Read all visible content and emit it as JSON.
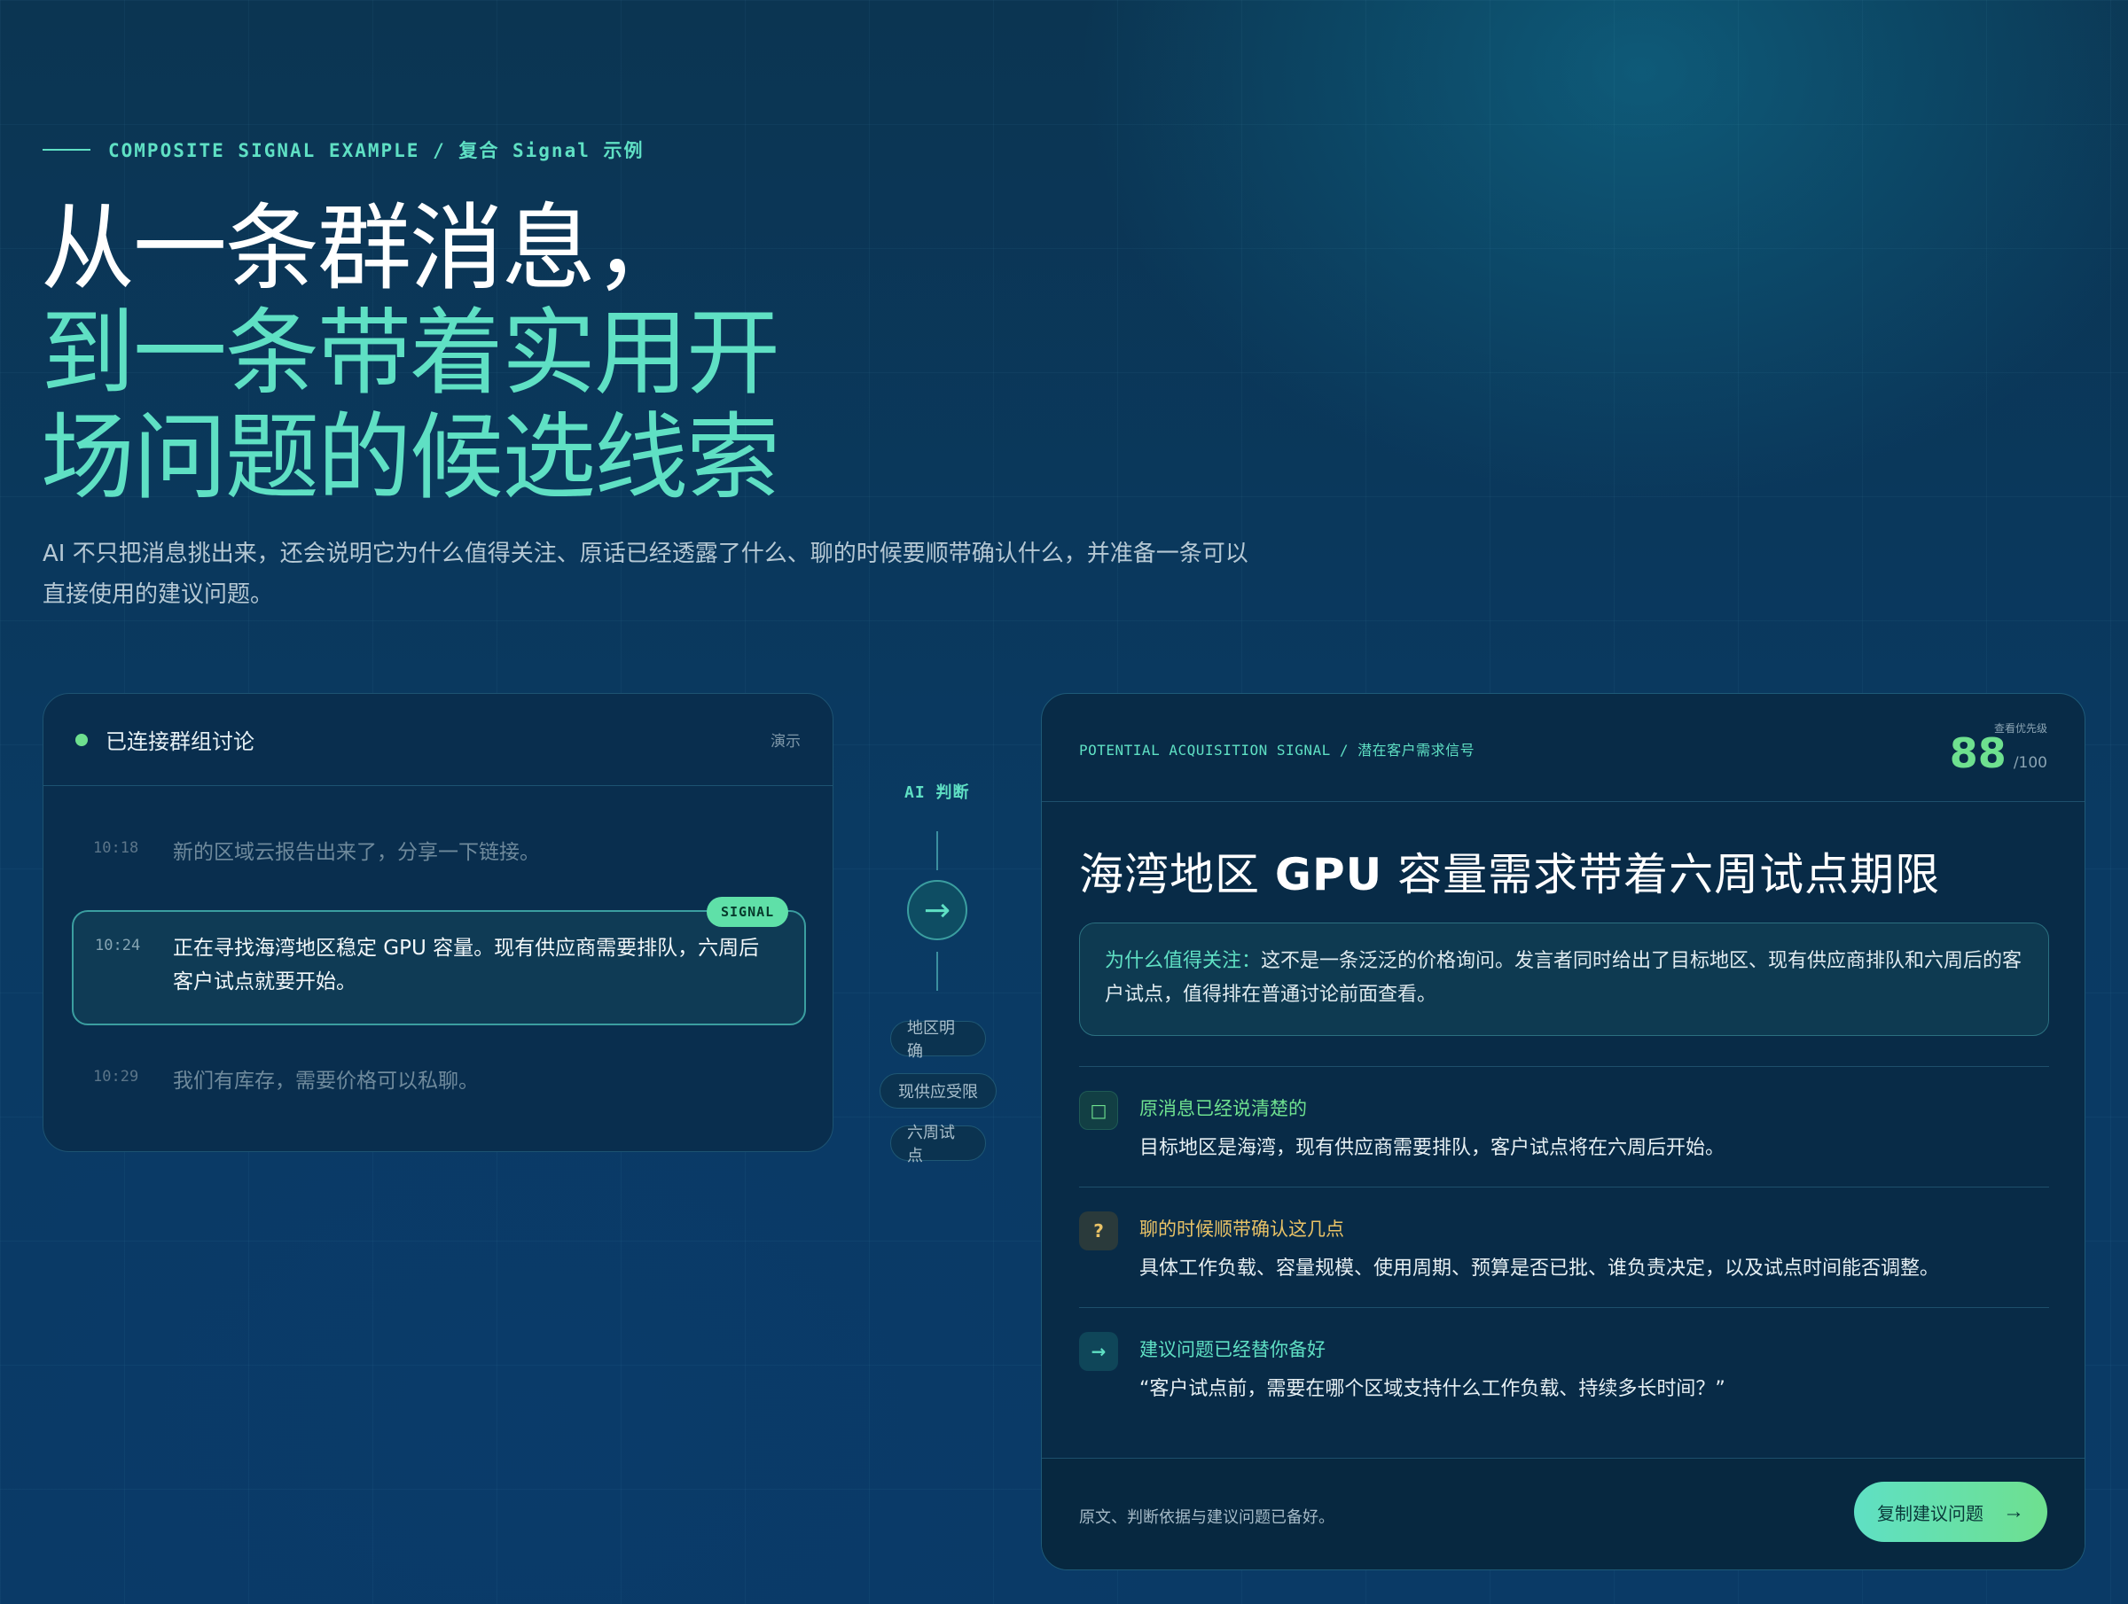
{
  "header": {
    "eyebrow": "COMPOSITE SIGNAL EXAMPLE / 复合 Signal 示例",
    "title_line1": "从一条群消息，",
    "title_line2": "到一条带着实用开",
    "title_line3": "场问题的候选线索",
    "description": "AI 不只把消息挑出来，还会说明它为什么值得关注、原话已经透露了什么、聊的时候要顺带确认什么，并准备一条可以直接使用的建议问题。"
  },
  "chat": {
    "title": "已连接群组讨论",
    "demo_label": "演示",
    "messages": [
      {
        "time": "10:18",
        "text": "新的区域云报告出来了，分享一下链接。"
      },
      {
        "time": "10:24",
        "text": "正在寻找海湾地区稳定 GPU 容量。现有供应商需要排队，六周后客户试点就要开始。",
        "badge": "SIGNAL"
      },
      {
        "time": "10:29",
        "text": "我们有库存，需要价格可以私聊。"
      }
    ]
  },
  "connector": {
    "label": "AI 判断",
    "arrow": "→",
    "chips": [
      "地区明确",
      "现供应受限",
      "六周试点"
    ]
  },
  "signal_card": {
    "tag": "POTENTIAL ACQUISITION SIGNAL / 潜在客户需求信号",
    "score_label": "查看优先级",
    "score": "88",
    "score_max": "/100",
    "title_pre": "海湾地区 ",
    "title_bold": "GPU",
    "title_post": " 容量需求带着六周试点期限",
    "why_label": "为什么值得关注：",
    "why_text": "这不是一条泛泛的价格询问。发言者同时给出了目标地区、现有供应商排队和六周后的客户试点，值得排在普通讨论前面查看。",
    "items": [
      {
        "icon": "□",
        "heading": "原消息已经说清楚的",
        "body": "目标地区是海湾，现有供应商需要排队，客户试点将在六周后开始。"
      },
      {
        "icon": "?",
        "heading": "聊的时候顺带确认这几点",
        "body": "具体工作负载、容量规模、使用周期、预算是否已批、谁负责决定，以及试点时间能否调整。"
      },
      {
        "icon": "→",
        "heading": "建议问题已经替你备好",
        "body": "“客户试点前，需要在哪个区域支持什么工作负载、持续多长时间？”"
      }
    ],
    "footer_note": "原文、判断依据与建议问题已备好。",
    "copy_button": "复制建议问题",
    "copy_arrow": "→"
  },
  "colors": {
    "accent": "#5fe0c4",
    "green": "#6ee08f",
    "amber": "#e9c266",
    "background": "#0a3a63"
  }
}
